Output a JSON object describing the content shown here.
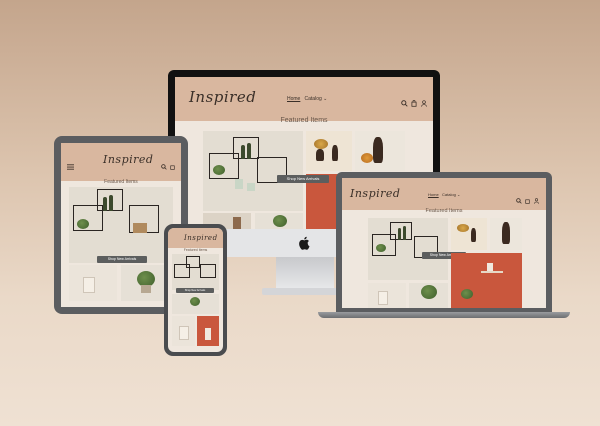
{
  "site": {
    "logo": "Inspired",
    "nav": {
      "home": "Home",
      "catalog": "Catalog",
      "catalog_caret": "⌄"
    },
    "featured_title": "Featured Items",
    "cta_label": "Shop New Arrivals"
  },
  "icons": [
    "search-icon",
    "bag-icon",
    "account-icon",
    "menu-icon",
    "apple-logo-icon"
  ],
  "colors": {
    "background": "#d6bca5",
    "header": "#d9b79f",
    "button": "#5c5e5e",
    "terracotta": "#c9573d",
    "device_frame": "#5b5d60"
  }
}
